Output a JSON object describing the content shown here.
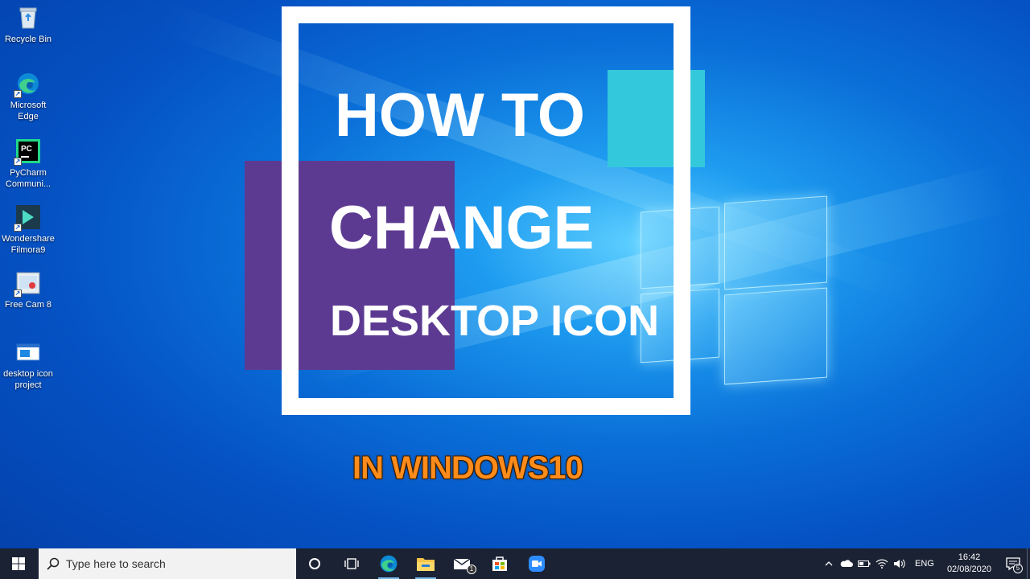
{
  "desktop": {
    "icons": [
      {
        "label": "Recycle Bin",
        "icon": "recycle-bin-icon"
      },
      {
        "label": "Microsoft Edge",
        "icon": "edge-icon"
      },
      {
        "label": "PyCharm Communi...",
        "icon": "pycharm-icon"
      },
      {
        "label": "Wondershare Filmora9",
        "icon": "filmora-icon"
      },
      {
        "label": "Free Cam 8",
        "icon": "free-cam-icon"
      },
      {
        "label": "desktop icon project",
        "icon": "window-project-icon"
      }
    ]
  },
  "thumbnail": {
    "line1": "HOW TO",
    "line2": "CHANGE",
    "line3": "DESKTOP ICON",
    "subtitle": "IN WINDOWS10",
    "colors": {
      "purple": "#5d3a92",
      "cyan": "#33c8dc",
      "frame": "#ffffff",
      "subtitle": "#ff8c1a"
    }
  },
  "taskbar": {
    "search_placeholder": "Type here to search",
    "apps": [
      "task-view-icon",
      "edge-icon",
      "file-explorer-icon",
      "mail-icon",
      "store-icon",
      "zoom-icon"
    ],
    "mail_badge": "1",
    "tray": {
      "language": "ENG",
      "time": "16:42",
      "date": "02/08/2020",
      "notifications": "5"
    }
  }
}
